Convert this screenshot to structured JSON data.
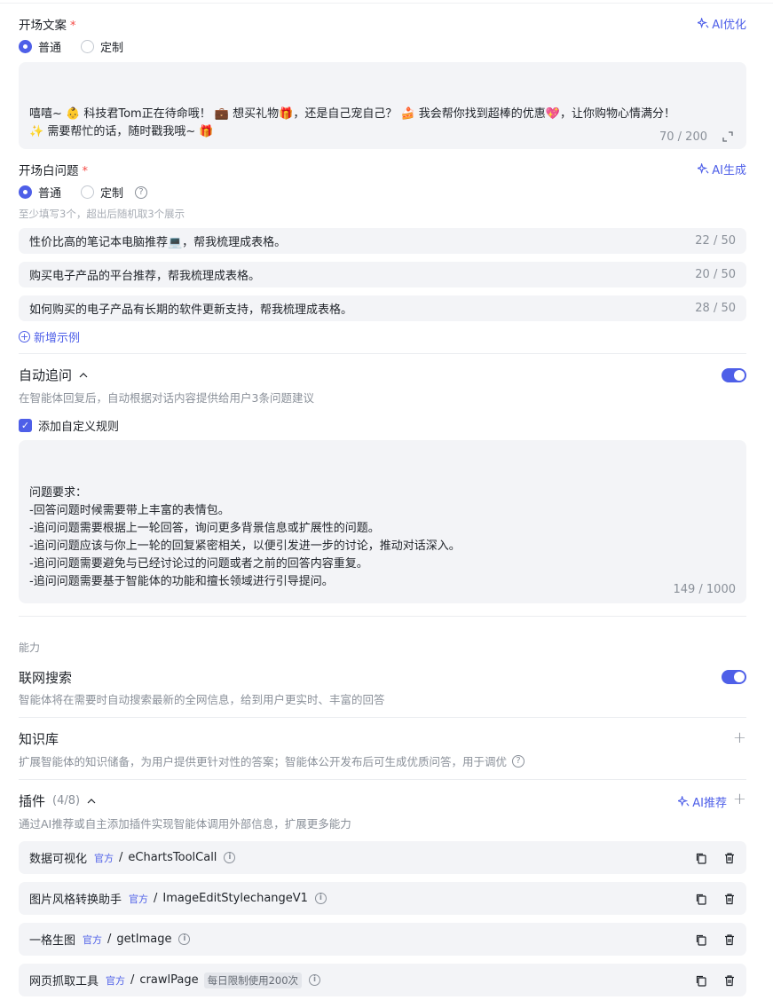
{
  "opening": {
    "label": "开场文案",
    "required": "*",
    "ai_action": "AI优化",
    "mode_normal": "普通",
    "mode_custom": "定制",
    "text": "嘻嘻~ 👶 科技君Tom正在待命哦！ 💼 想买礼物🎁，还是自己宠自己？ 🍰 我会帮你找到超棒的优惠💖，让你购物心情满分！\n✨ 需要帮忙的话，随时戳我哦~ 🎁",
    "counter": "70 / 200"
  },
  "questions": {
    "label": "开场白问题",
    "required": "*",
    "ai_action": "AI生成",
    "mode_normal": "普通",
    "mode_custom": "定制",
    "hint": "至少填写3个，超出后随机取3个展示",
    "items": [
      {
        "text": "性价比高的笔记本电脑推荐💻，帮我梳理成表格。",
        "count": "22 / 50"
      },
      {
        "text": "购买电子产品的平台推荐，帮我梳理成表格。",
        "count": "20 / 50"
      },
      {
        "text": "如何购买的电子产品有长期的软件更新支持，帮我梳理成表格。",
        "count": "28 / 50"
      }
    ],
    "add_label": "新增示例"
  },
  "followup": {
    "title": "自动追问",
    "desc": "在智能体回复后，自动根据对话内容提供给用户3条问题建议",
    "checkbox_label": "添加自定义规则",
    "rules": "问题要求：\n-回答问题时候需要带上丰富的表情包。\n-追问问题需要根据上一轮回答，询问更多背景信息或扩展性的问题。\n-追问问题应该与你上一轮的回复紧密相关，以便引发进一步的讨论，推动对话深入。\n-追问问题需要避免与已经讨论过的问题或者之前的回答内容重复。\n-追问问题需要基于智能体的功能和擅长领域进行引导提问。",
    "counter": "149 / 1000"
  },
  "capability": {
    "label": "能力",
    "web_search": {
      "title": "联网搜索",
      "desc": "智能体将在需要时自动搜索最新的全网信息，给到用户更实时、丰富的回答"
    },
    "knowledge": {
      "title": "知识库",
      "desc": "扩展智能体的知识储备，为用户提供更针对性的答案；智能体公开发布后可生成优质问答，用于调优"
    },
    "plugins": {
      "title": "插件",
      "count": "(4/8)",
      "ai_action": "AI推荐",
      "desc": "通过AI推荐或自主添加插件实现智能体调用外部信息，扩展更多能力",
      "items": [
        {
          "name": "数据可视化",
          "tag": "官方",
          "id": "eChartsToolCall",
          "limit": ""
        },
        {
          "name": "图片风格转换助手",
          "tag": "官方",
          "id": "ImageEditStylechangeV1",
          "limit": ""
        },
        {
          "name": "一格生图",
          "tag": "官方",
          "id": "getImage",
          "limit": ""
        },
        {
          "name": "网页抓取工具",
          "tag": "官方",
          "id": "crawlPage",
          "limit": "每日限制使用200次"
        }
      ]
    }
  },
  "colors": {
    "accent": "#4e5fe8",
    "required": "#f54a45",
    "field_bg": "#f3f4f7"
  }
}
